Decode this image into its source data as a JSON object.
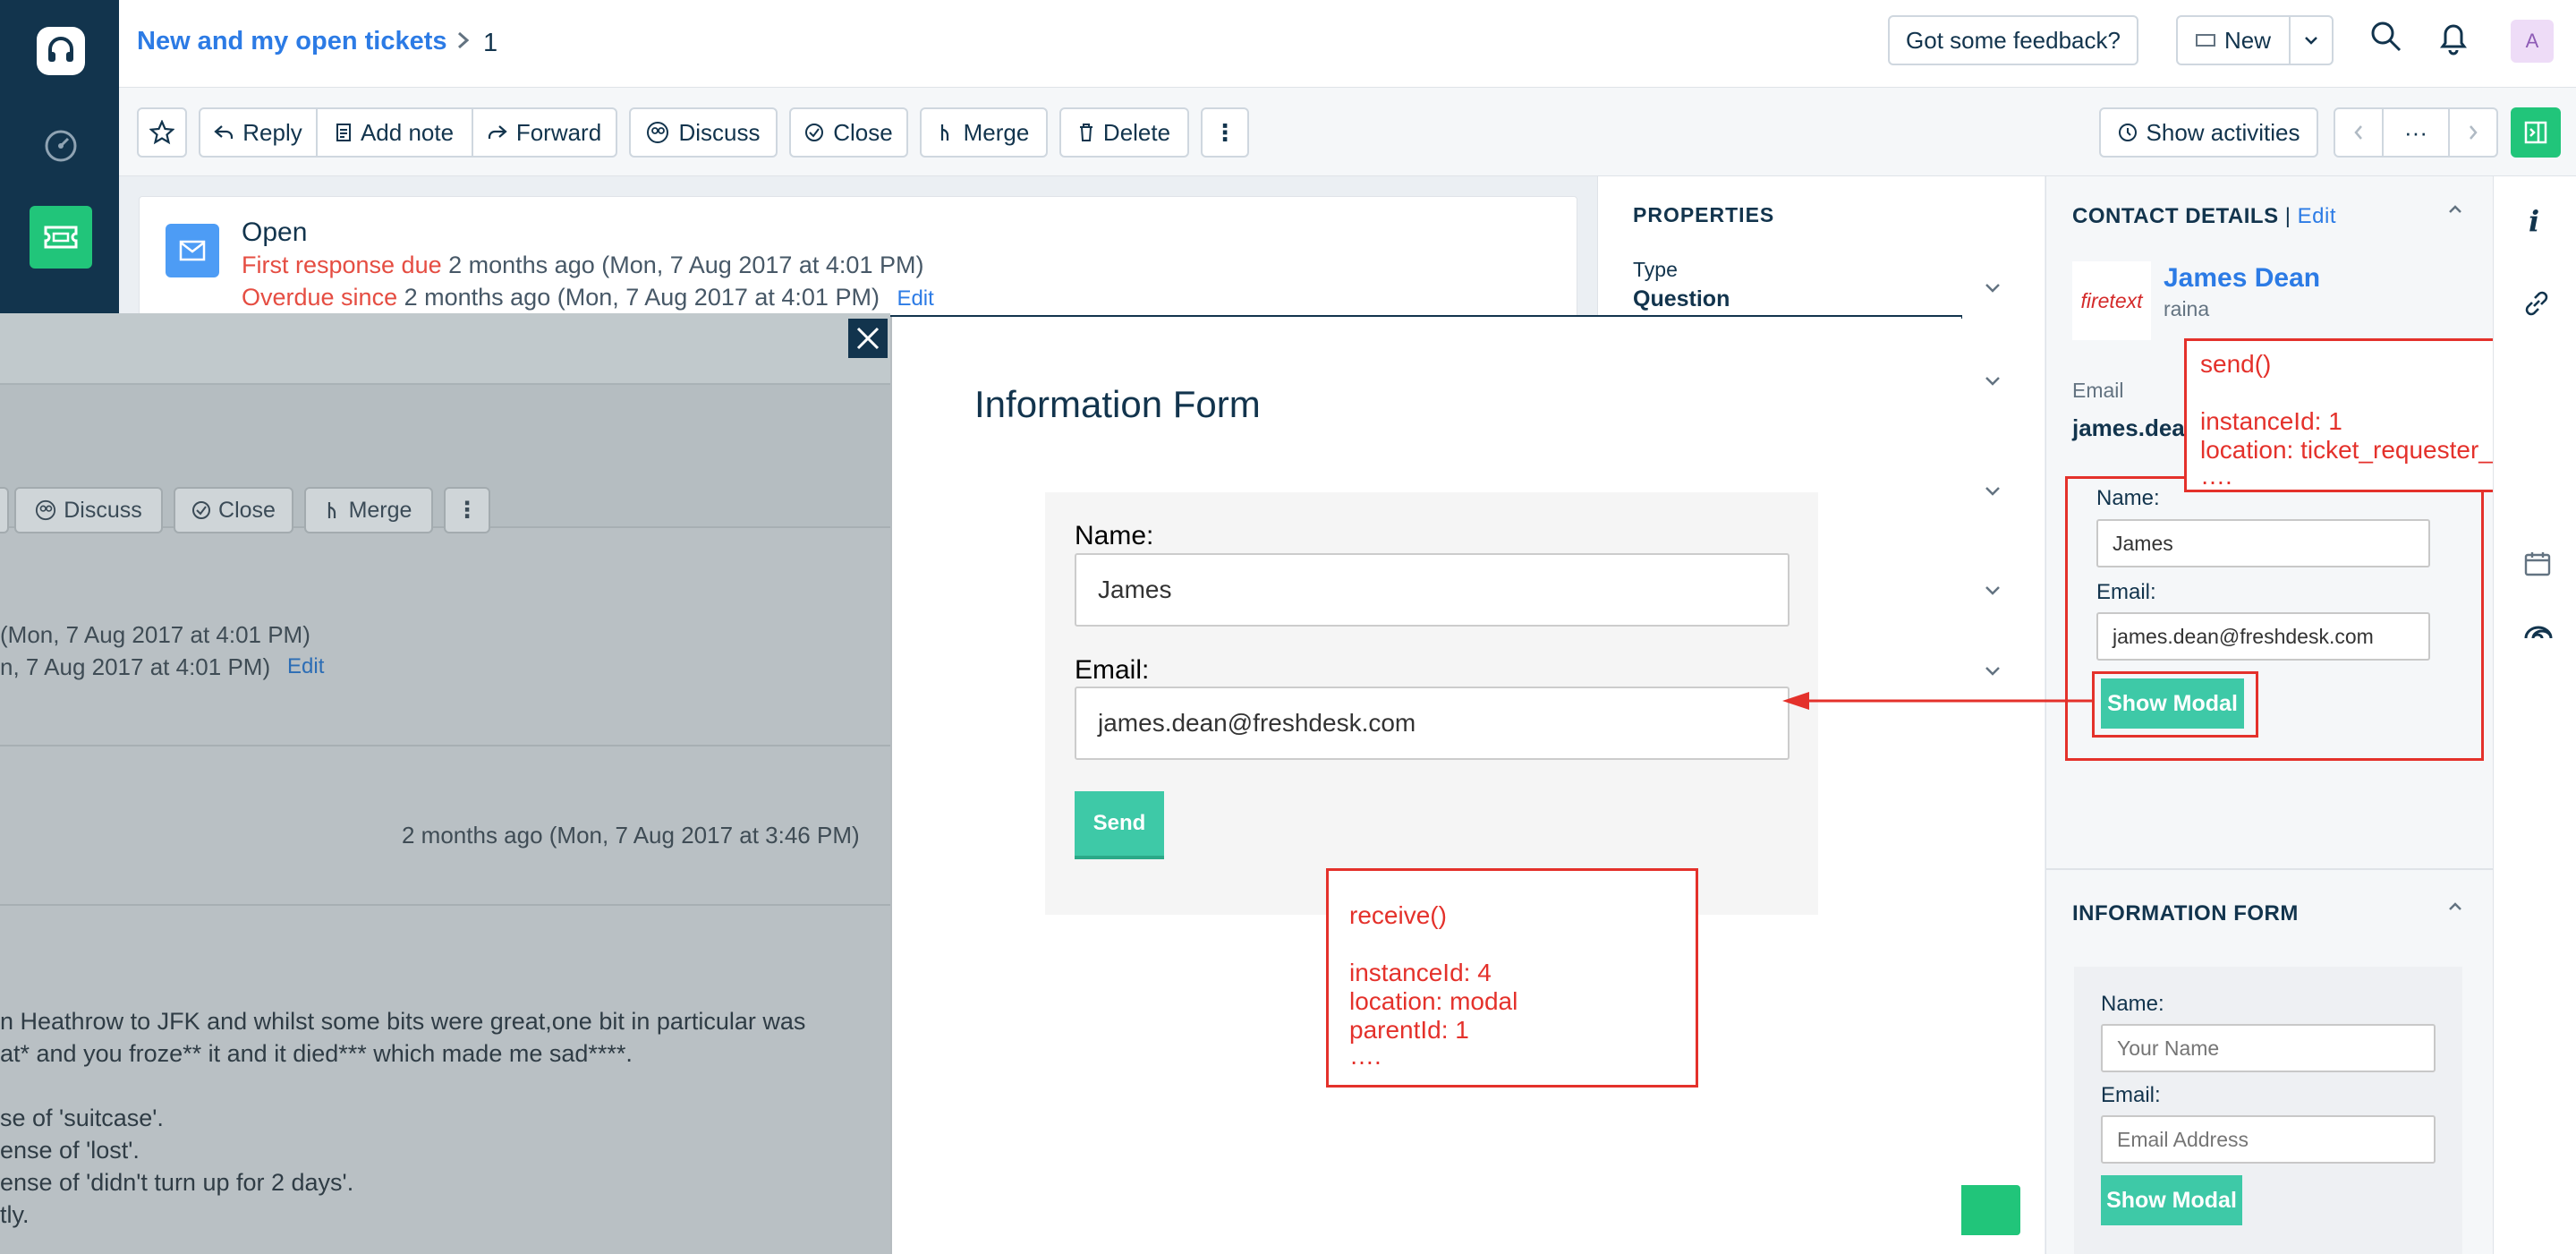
{
  "header": {
    "breadcrumb_link": "New and my open tickets",
    "breadcrumb_sep": ">",
    "breadcrumb_current": "1",
    "feedback_label": "Got some feedback?",
    "new_label": "New",
    "avatar_initial": "A"
  },
  "toolbar": {
    "reply": "Reply",
    "add_note": "Add note",
    "forward": "Forward",
    "discuss": "Discuss",
    "close": "Close",
    "merge": "Merge",
    "delete": "Delete",
    "more": "⋮",
    "show_activities": "Show activities",
    "pager_more": "···"
  },
  "ticket": {
    "status": "Open",
    "first_response_label": "First response due",
    "first_response_value": "2 months ago (Mon, 7 Aug 2017 at 4:01 PM)",
    "overdue_label": "Overdue since",
    "overdue_value": "2 months ago (Mon, 7 Aug 2017 at 4:01 PM)",
    "edit": "Edit"
  },
  "properties": {
    "title": "PROPERTIES",
    "type_label": "Type",
    "type_value": "Question"
  },
  "contact": {
    "title": "CONTACT DETAILS",
    "separator": "|",
    "edit": "Edit",
    "name": "James Dean",
    "company": "raina",
    "logo_text": "firetext",
    "email_label": "Email",
    "email_value": "james.dea",
    "app_name_label": "Name:",
    "app_name_value": "James",
    "app_email_label": "Email:",
    "app_email_value": "james.dean@freshdesk.com",
    "app_button": "Show Modal"
  },
  "info_form_panel": {
    "title": "INFORMATION FORM",
    "name_label": "Name:",
    "name_placeholder": "Your Name",
    "email_label": "Email:",
    "email_placeholder": "Email Address",
    "button": "Show Modal"
  },
  "overlay": {
    "discuss": "Discuss",
    "close": "Close",
    "merge": "Merge",
    "more": "⋮",
    "line1": "(Mon, 7 Aug 2017 at 4:01 PM)",
    "line2": "n, 7 Aug 2017 at 4:01 PM)",
    "edit": "Edit",
    "timestamp": "2 months ago (Mon, 7 Aug 2017 at 3:46 PM)",
    "body": [
      "n Heathrow to JFK and whilst some bits were great,one bit in particular was",
      "at* and you froze** it and it died*** which made me sad****.",
      "",
      "se of 'suitcase'.",
      "ense of 'lost'.",
      "ense of 'didn't turn up for 2 days'.",
      "tly."
    ]
  },
  "modal": {
    "title": "Information Form",
    "name_label": "Name:",
    "name_value": "James",
    "email_label": "Email:",
    "email_value": "james.dean@freshdesk.com",
    "send": "Send"
  },
  "annotations": {
    "send": {
      "fn": "send()",
      "instance": "instanceId: 1",
      "location": "location: ticket_requester_info",
      "ellipsis": "…."
    },
    "receive": {
      "fn": "receive()",
      "instance": "instanceId: 4",
      "location": "location: modal",
      "parent": "parentId: 1",
      "ellipsis": "…."
    }
  },
  "colors": {
    "nav_bg": "#12344d",
    "accent_green": "#21c57a",
    "link_blue": "#2c7be5",
    "app_button": "#3ec9a7",
    "annotation_red": "#e4312b",
    "overdue_red": "#e54d42"
  }
}
